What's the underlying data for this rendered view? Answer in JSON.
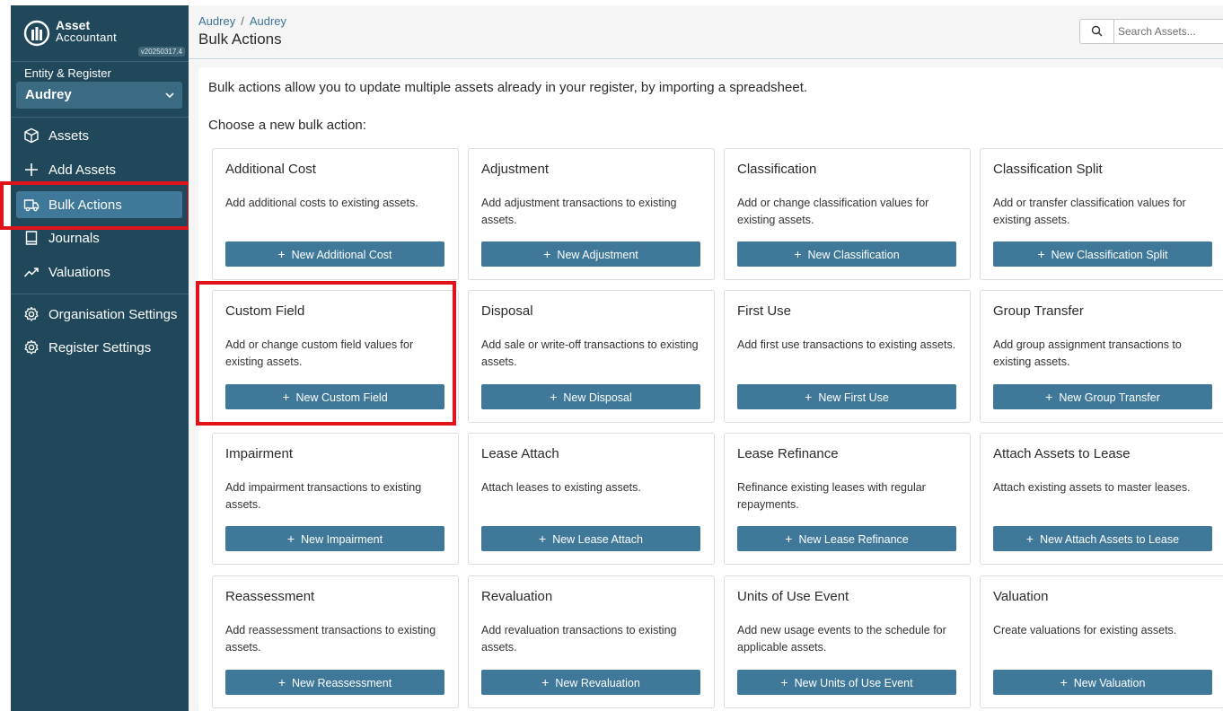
{
  "brand": {
    "name": "Asset",
    "subtitle": "Accountant",
    "version": "v20250317.4"
  },
  "entity": {
    "label": "Entity & Register",
    "selected": "Audrey"
  },
  "nav": {
    "assets": "Assets",
    "add_assets": "Add Assets",
    "bulk_actions": "Bulk Actions",
    "journals": "Journals",
    "valuations": "Valuations",
    "org_settings": "Organisation Settings",
    "register_settings": "Register Settings"
  },
  "header": {
    "breadcrumb": [
      "Audrey",
      "Audrey"
    ],
    "title": "Bulk Actions",
    "search_placeholder": "Search Assets..."
  },
  "main": {
    "intro": "Bulk actions allow you to update multiple assets already in your register, by importing a spreadsheet.",
    "choose": "Choose a new bulk action:",
    "cards": [
      {
        "title": "Additional Cost",
        "desc": "Add additional costs to existing assets.",
        "button": "New Additional Cost"
      },
      {
        "title": "Adjustment",
        "desc": "Add adjustment transactions to existing assets.",
        "button": "New Adjustment"
      },
      {
        "title": "Classification",
        "desc": "Add or change classification values for existing assets.",
        "button": "New Classification"
      },
      {
        "title": "Classification Split",
        "desc": "Add or transfer classification values for existing assets.",
        "button": "New Classification Split"
      },
      {
        "title": "Custom Field",
        "desc": "Add or change custom field values for existing assets.",
        "button": "New Custom Field"
      },
      {
        "title": "Disposal",
        "desc": "Add sale or write-off transactions to existing assets.",
        "button": "New Disposal"
      },
      {
        "title": "First Use",
        "desc": "Add first use transactions to existing assets.",
        "button": "New First Use"
      },
      {
        "title": "Group Transfer",
        "desc": "Add group assignment transactions to existing assets.",
        "button": "New Group Transfer"
      },
      {
        "title": "Impairment",
        "desc": "Add impairment transactions to existing assets.",
        "button": "New Impairment"
      },
      {
        "title": "Lease Attach",
        "desc": "Attach leases to existing assets.",
        "button": "New Lease Attach"
      },
      {
        "title": "Lease Refinance",
        "desc": "Refinance existing leases with regular repayments.",
        "button": "New Lease Refinance"
      },
      {
        "title": "Attach Assets to Lease",
        "desc": "Attach existing assets to master leases.",
        "button": "New Attach Assets to Lease"
      },
      {
        "title": "Reassessment",
        "desc": "Add reassessment transactions to existing assets.",
        "button": "New Reassessment"
      },
      {
        "title": "Revaluation",
        "desc": "Add revaluation transactions to existing assets.",
        "button": "New Revaluation"
      },
      {
        "title": "Units of Use Event",
        "desc": "Add new usage events to the schedule for applicable assets.",
        "button": "New Units of Use Event"
      },
      {
        "title": "Valuation",
        "desc": "Create valuations for existing assets.",
        "button": "New Valuation"
      }
    ]
  },
  "colors": {
    "sidebar": "#21485a",
    "accent": "#3f7899",
    "highlight": "#e0131b"
  }
}
